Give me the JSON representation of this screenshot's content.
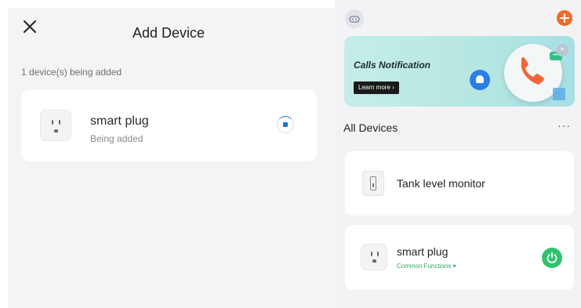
{
  "left": {
    "title": "Add Device",
    "status_text": "1 device(s) being added",
    "device": {
      "name": "smart plug",
      "status": "Being added"
    }
  },
  "right": {
    "banner": {
      "title": "Calls Notification",
      "button_label": "Learn more ›",
      "chat_glyph": "•••",
      "close_glyph": "×"
    },
    "section_title": "All Devices",
    "more_glyph": "···",
    "devices": [
      {
        "name": "Tank level monitor"
      },
      {
        "name": "smart plug",
        "sub_label": "Common Functions ▾"
      }
    ]
  },
  "colors": {
    "accent_blue": "#1f6fd6",
    "add_orange": "#f06a2a",
    "power_green": "#2fc36f",
    "banner_teal": "#b7e7e2"
  },
  "icons": [
    "close-icon",
    "plug-icon",
    "loading-spinner-icon",
    "avatar-icon",
    "add-icon",
    "bell-icon",
    "phone-icon",
    "chat-icon",
    "more-icon",
    "tank-monitor-icon",
    "power-icon"
  ]
}
